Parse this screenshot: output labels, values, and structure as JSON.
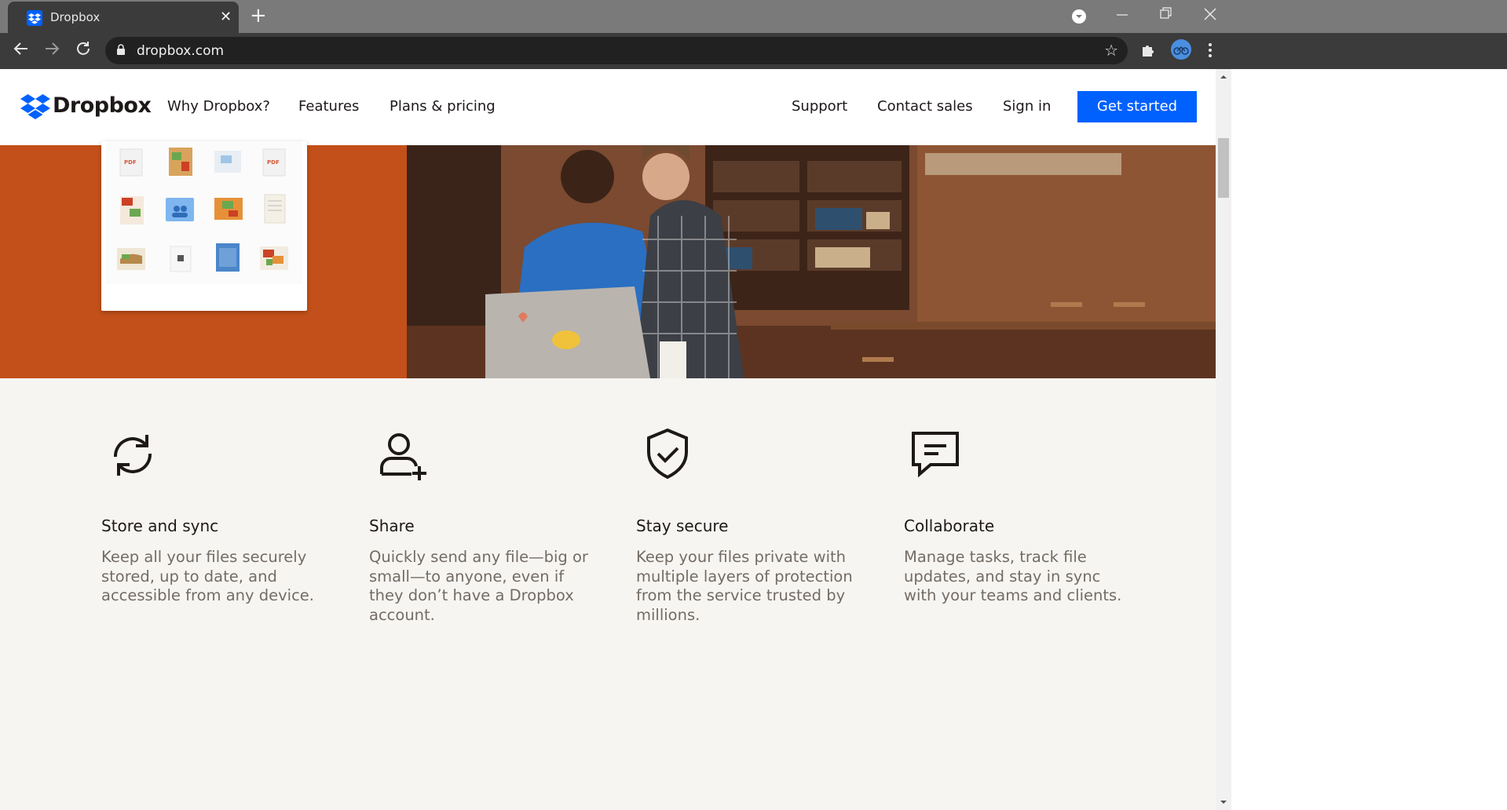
{
  "browser": {
    "tab_title": "Dropbox",
    "url": "dropbox.com"
  },
  "header": {
    "brand": "Dropbox",
    "nav_left": [
      "Why Dropbox?",
      "Features",
      "Plans & pricing"
    ],
    "nav_right": [
      "Support",
      "Contact sales",
      "Sign in"
    ],
    "cta": "Get started"
  },
  "hero": {
    "file_labels": [
      "PDF",
      "PDF"
    ]
  },
  "features": [
    {
      "title": "Store and sync",
      "text": "Keep all your files securely stored, up to date, and accessible from any device.",
      "icon": "sync-icon"
    },
    {
      "title": "Share",
      "text": "Quickly send any file—big or small—to anyone, even if they don’t have a Dropbox account.",
      "icon": "add-user-icon"
    },
    {
      "title": "Stay secure",
      "text": "Keep your files private with multiple layers of protection from the service trusted by millions.",
      "icon": "shield-check-icon"
    },
    {
      "title": "Collaborate",
      "text": "Manage tasks, track file updates, and stay in sync with your teams and clients.",
      "icon": "chat-icon"
    }
  ],
  "colors": {
    "brand_blue": "#0061fe",
    "hero_orange": "#c3501a",
    "feature_bg": "#f7f5f2"
  }
}
